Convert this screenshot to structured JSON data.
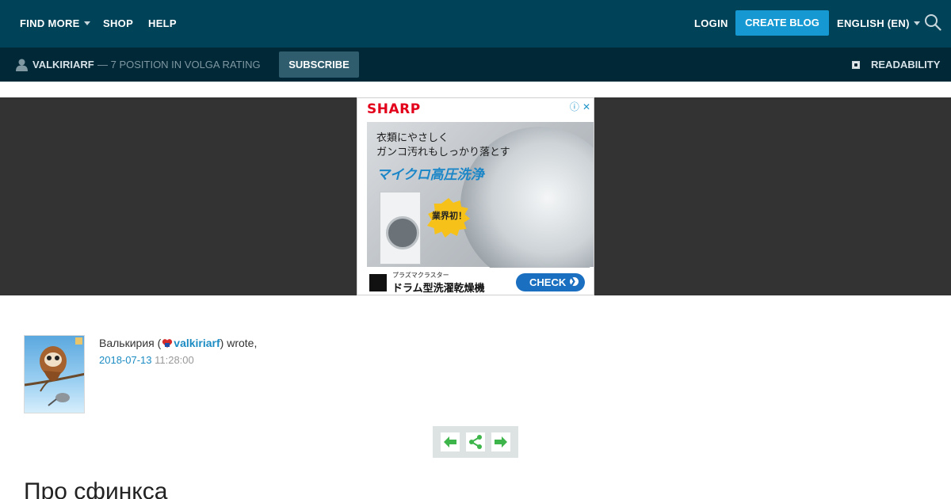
{
  "topnav": {
    "find_more": "FIND MORE",
    "shop": "SHOP",
    "help": "HELP",
    "login": "LOGIN",
    "create_blog": "CREATE BLOG",
    "language": "ENGLISH (EN)"
  },
  "subbar": {
    "username": "VALKIRIARF",
    "rating": "— 7 POSITION IN VOLGA RATING",
    "subscribe": "SUBSCRIBE",
    "readability": "READABILITY"
  },
  "ad": {
    "brand": "SHARP",
    "line1": "衣類にやさしく",
    "line2": "ガンコ汚れもしっかり落とす",
    "headline": "マイクロ高圧洗浄",
    "badge": "業界初！",
    "small": "プラズマクラスター",
    "product": "ドラム型洗濯乾燥機",
    "cta": "CHECK"
  },
  "post": {
    "author_name": "Валькирия (",
    "author_user": "valkiriarf",
    "wrote": ") wrote,",
    "date": "2018-07-13",
    "time": " 11:28:00",
    "title": "Про сфинкса"
  },
  "colors": {
    "topbar": "#004359",
    "subbar": "#002837",
    "accent": "#1699d2",
    "link": "#1c8cc3",
    "nav_arrow": "#3db54a"
  }
}
